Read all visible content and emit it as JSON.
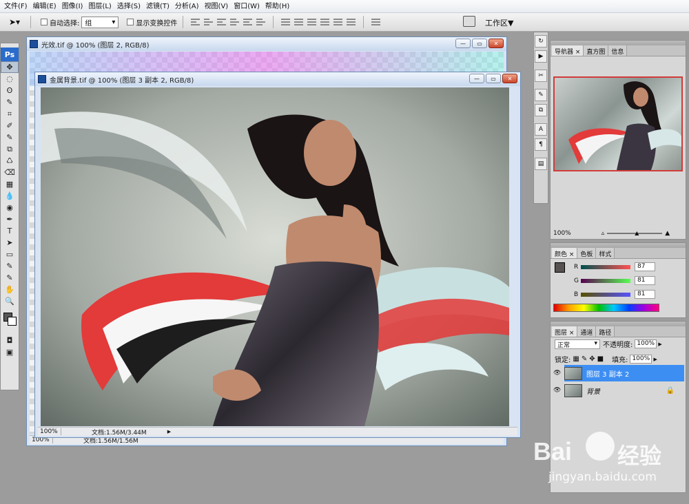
{
  "menubar": {
    "items": [
      "文件(F)",
      "编辑(E)",
      "图像(I)",
      "图层(L)",
      "选择(S)",
      "滤镜(T)",
      "分析(A)",
      "视图(V)",
      "窗口(W)",
      "帮助(H)"
    ]
  },
  "options": {
    "auto_select_label": "自动选择:",
    "auto_select_value": "组",
    "show_transform_label": "显示变换控件",
    "workspace_label": "工作区▼"
  },
  "toolbox": {
    "logo": "Ps",
    "tools": [
      "✥",
      "◌",
      "ʘ",
      "✎",
      "⌗",
      "✐",
      "✎",
      "⧉",
      "♺",
      "⌫",
      "▦",
      "💧",
      "◉",
      "✒",
      "T",
      "➤",
      "▭",
      "✎",
      "✎",
      "✋",
      "🔍"
    ]
  },
  "doc_back": {
    "title": "光效.tif @ 100% (图层 2, RGB/8)",
    "zoom": "100%",
    "doc_info": "文档:1.56M/1.56M"
  },
  "doc_front": {
    "title": "金属背景.tif @ 100% (图层 3 副本 2, RGB/8)",
    "zoom": "100%",
    "doc_info": "文档:1.56M/3.44M"
  },
  "navigator": {
    "tabs": [
      "导航器 ×",
      "直方图",
      "信息"
    ],
    "zoom": "100%"
  },
  "color_panel": {
    "tabs": [
      "颜色 ×",
      "色板",
      "样式"
    ],
    "r_label": "R",
    "g_label": "G",
    "b_label": "B",
    "r": "87",
    "g": "81",
    "b": "81",
    "fg_color": "#575151"
  },
  "layers_panel": {
    "tabs": [
      "图层 ×",
      "通道",
      "路径"
    ],
    "blend_mode": "正常",
    "opacity_label": "不透明度:",
    "opacity": "100%",
    "lock_label": "锁定:",
    "fill_label": "填充:",
    "fill": "100%",
    "layers": [
      {
        "name": "图层 3 副本 2",
        "active": true
      },
      {
        "name": "背景",
        "active": false
      }
    ]
  },
  "watermark": {
    "brand": "Bai",
    "brand2": "经验",
    "url": "jingyan.baidu.com"
  }
}
